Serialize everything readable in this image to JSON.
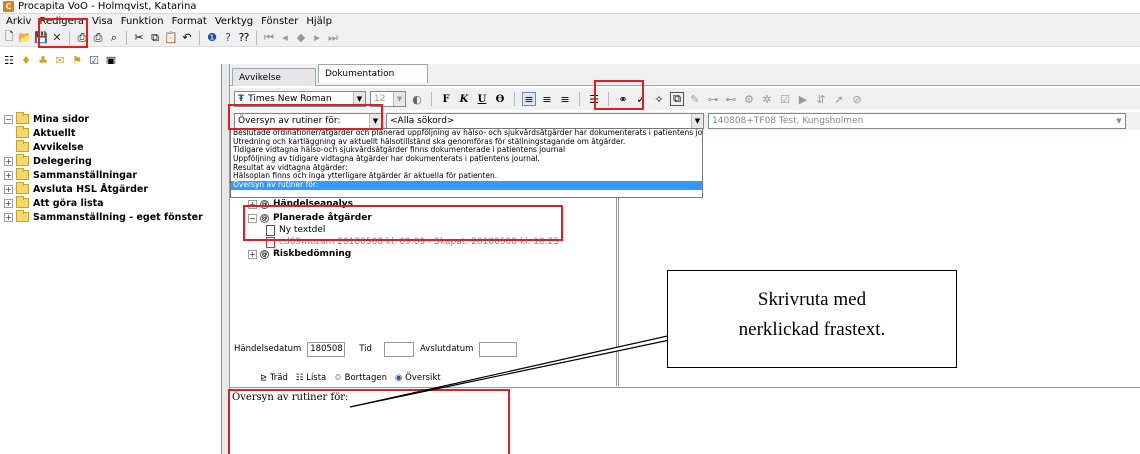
{
  "window": {
    "title": "Procapita VoO - Holmqvist, Katarina",
    "icon_letter": "C"
  },
  "menu": [
    "Arkiv",
    "Redigera",
    "Visa",
    "Funktion",
    "Format",
    "Verktyg",
    "Fönster",
    "Hjälp"
  ],
  "left_tree": [
    {
      "label": "Mina sidor",
      "expander": "−"
    },
    {
      "label": "Aktuellt",
      "expander": ""
    },
    {
      "label": "Avvikelse",
      "expander": ""
    },
    {
      "label": "Delegering",
      "expander": "+"
    },
    {
      "label": "Sammanställningar",
      "expander": "+"
    },
    {
      "label": "Avsluta HSL Åtgärder",
      "expander": "+"
    },
    {
      "label": "Att göra lista",
      "expander": "+"
    },
    {
      "label": "Sammanställning - eget fönster",
      "expander": "+"
    }
  ],
  "tabs": {
    "avvikelse": "Avvikelse",
    "dokumentation": "Dokumentation"
  },
  "format": {
    "font": "Times New Roman",
    "size": "12"
  },
  "selectors": {
    "phrase": "Översyn av rutiner för:",
    "search": "<Alla sökord>",
    "record": "140808+TF08 Test, Kungsholmen"
  },
  "dropdown_items": [
    "Beslutade ordinationer/åtgärder och planerad uppföljning av hälso- och sjukvårdsåtgärder har dokumenterats i patientens journal.",
    "Utredning och kartläggning av aktuellt hälsotillstånd ska genomföras för ställningstagande om åtgärder.",
    "Tidigare vidtagna hälso-och sjukvårdsåtgärder finns dokumenterade i patientens journal",
    "Uppföljning av tidigare vidtagna åtgärder har dokumenterats i patientens journal.",
    "Resultat av vidtagna åtgärder:",
    "Hälsoplan finns och inga ytterligare åtgärder är aktuella för patienten.",
    "Översyn av rutiner för:"
  ],
  "doc_tree": {
    "handelseanalys": "Händelseanalys",
    "planerade": "Planerade åtgärder",
    "ny_textdel": "Ny textdel",
    "entry": "cd69mozam 20180508 kl. 09:09 - Skapat: 20180508 kl. 10:25",
    "riskbedomning": "Riskbedömning"
  },
  "dates": {
    "handelsedatum_label": "Händelsedatum",
    "handelsedatum_value": "180508",
    "tid_label": "Tid",
    "avslutdatum_label": "Avslutdatum"
  },
  "bottom_tabs": [
    "Träd",
    "Lista",
    "Borttagen",
    "Översikt"
  ],
  "editor_text": "Översyn av rutiner för:",
  "callout_text": [
    "Skrivruta med",
    "nerklickad frastext."
  ],
  "colors": {
    "highlight": "#e02020",
    "selection": "#3399ff"
  }
}
